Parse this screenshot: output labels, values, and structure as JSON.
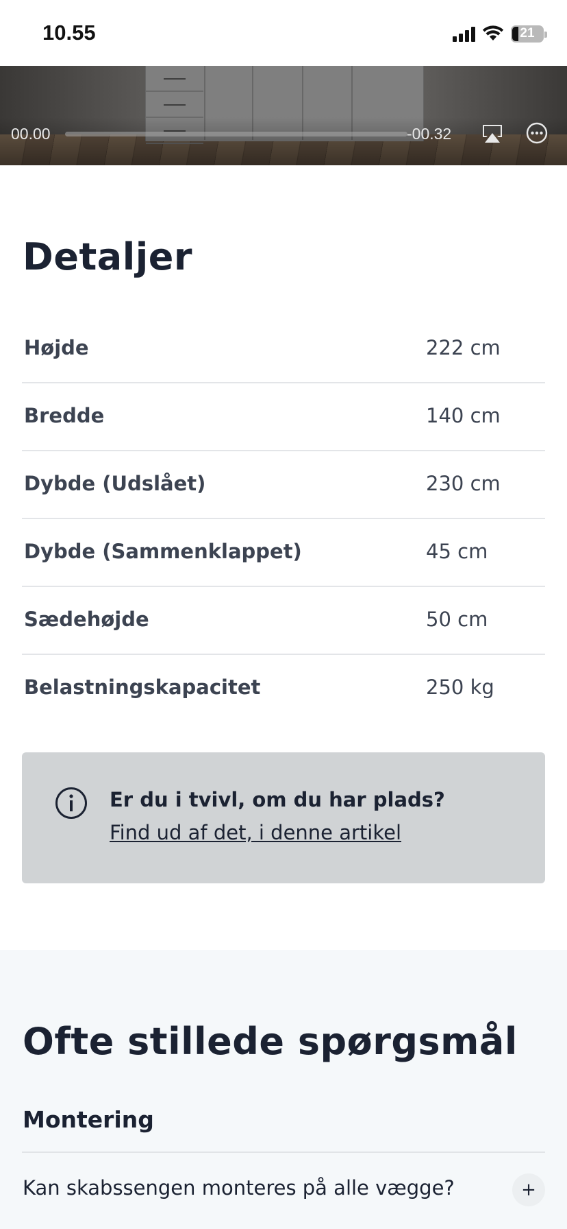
{
  "status_bar": {
    "time": "10.55",
    "battery": "21",
    "icons": [
      "signal-icon",
      "wifi-icon",
      "battery-icon"
    ]
  },
  "video": {
    "elapsed": "00.00",
    "remaining": "-00.32",
    "progress": 0,
    "icons": [
      "airplay-icon",
      "more-icon"
    ]
  },
  "details": {
    "title": "Detaljer",
    "rows": [
      {
        "label": "Højde",
        "value": "222 cm"
      },
      {
        "label": "Bredde",
        "value": "140 cm"
      },
      {
        "label": "Dybde (Udslået)",
        "value": "230 cm"
      },
      {
        "label": "Dybde (Sammenklappet)",
        "value": "45 cm"
      },
      {
        "label": "Sædehøjde",
        "value": "50 cm"
      },
      {
        "label": "Belastningskapacitet",
        "value": "250 kg"
      }
    ]
  },
  "info_box": {
    "icon": "info-icon",
    "question": "Er du i tvivl, om du har plads?",
    "link": "Find ud af det, i denne artikel"
  },
  "faq": {
    "title": "Ofte stillede spørgsmål",
    "category": "Montering",
    "question": "Kan skabssengen monteres på alle vægge?",
    "expand_label": "+"
  },
  "colors": {
    "heading": "#1b2232",
    "body_text": "#3c4351",
    "info_box_bg": "#d0d3d5",
    "faq_bg": "#f5f8fa",
    "divider": "#e3e5e8"
  }
}
